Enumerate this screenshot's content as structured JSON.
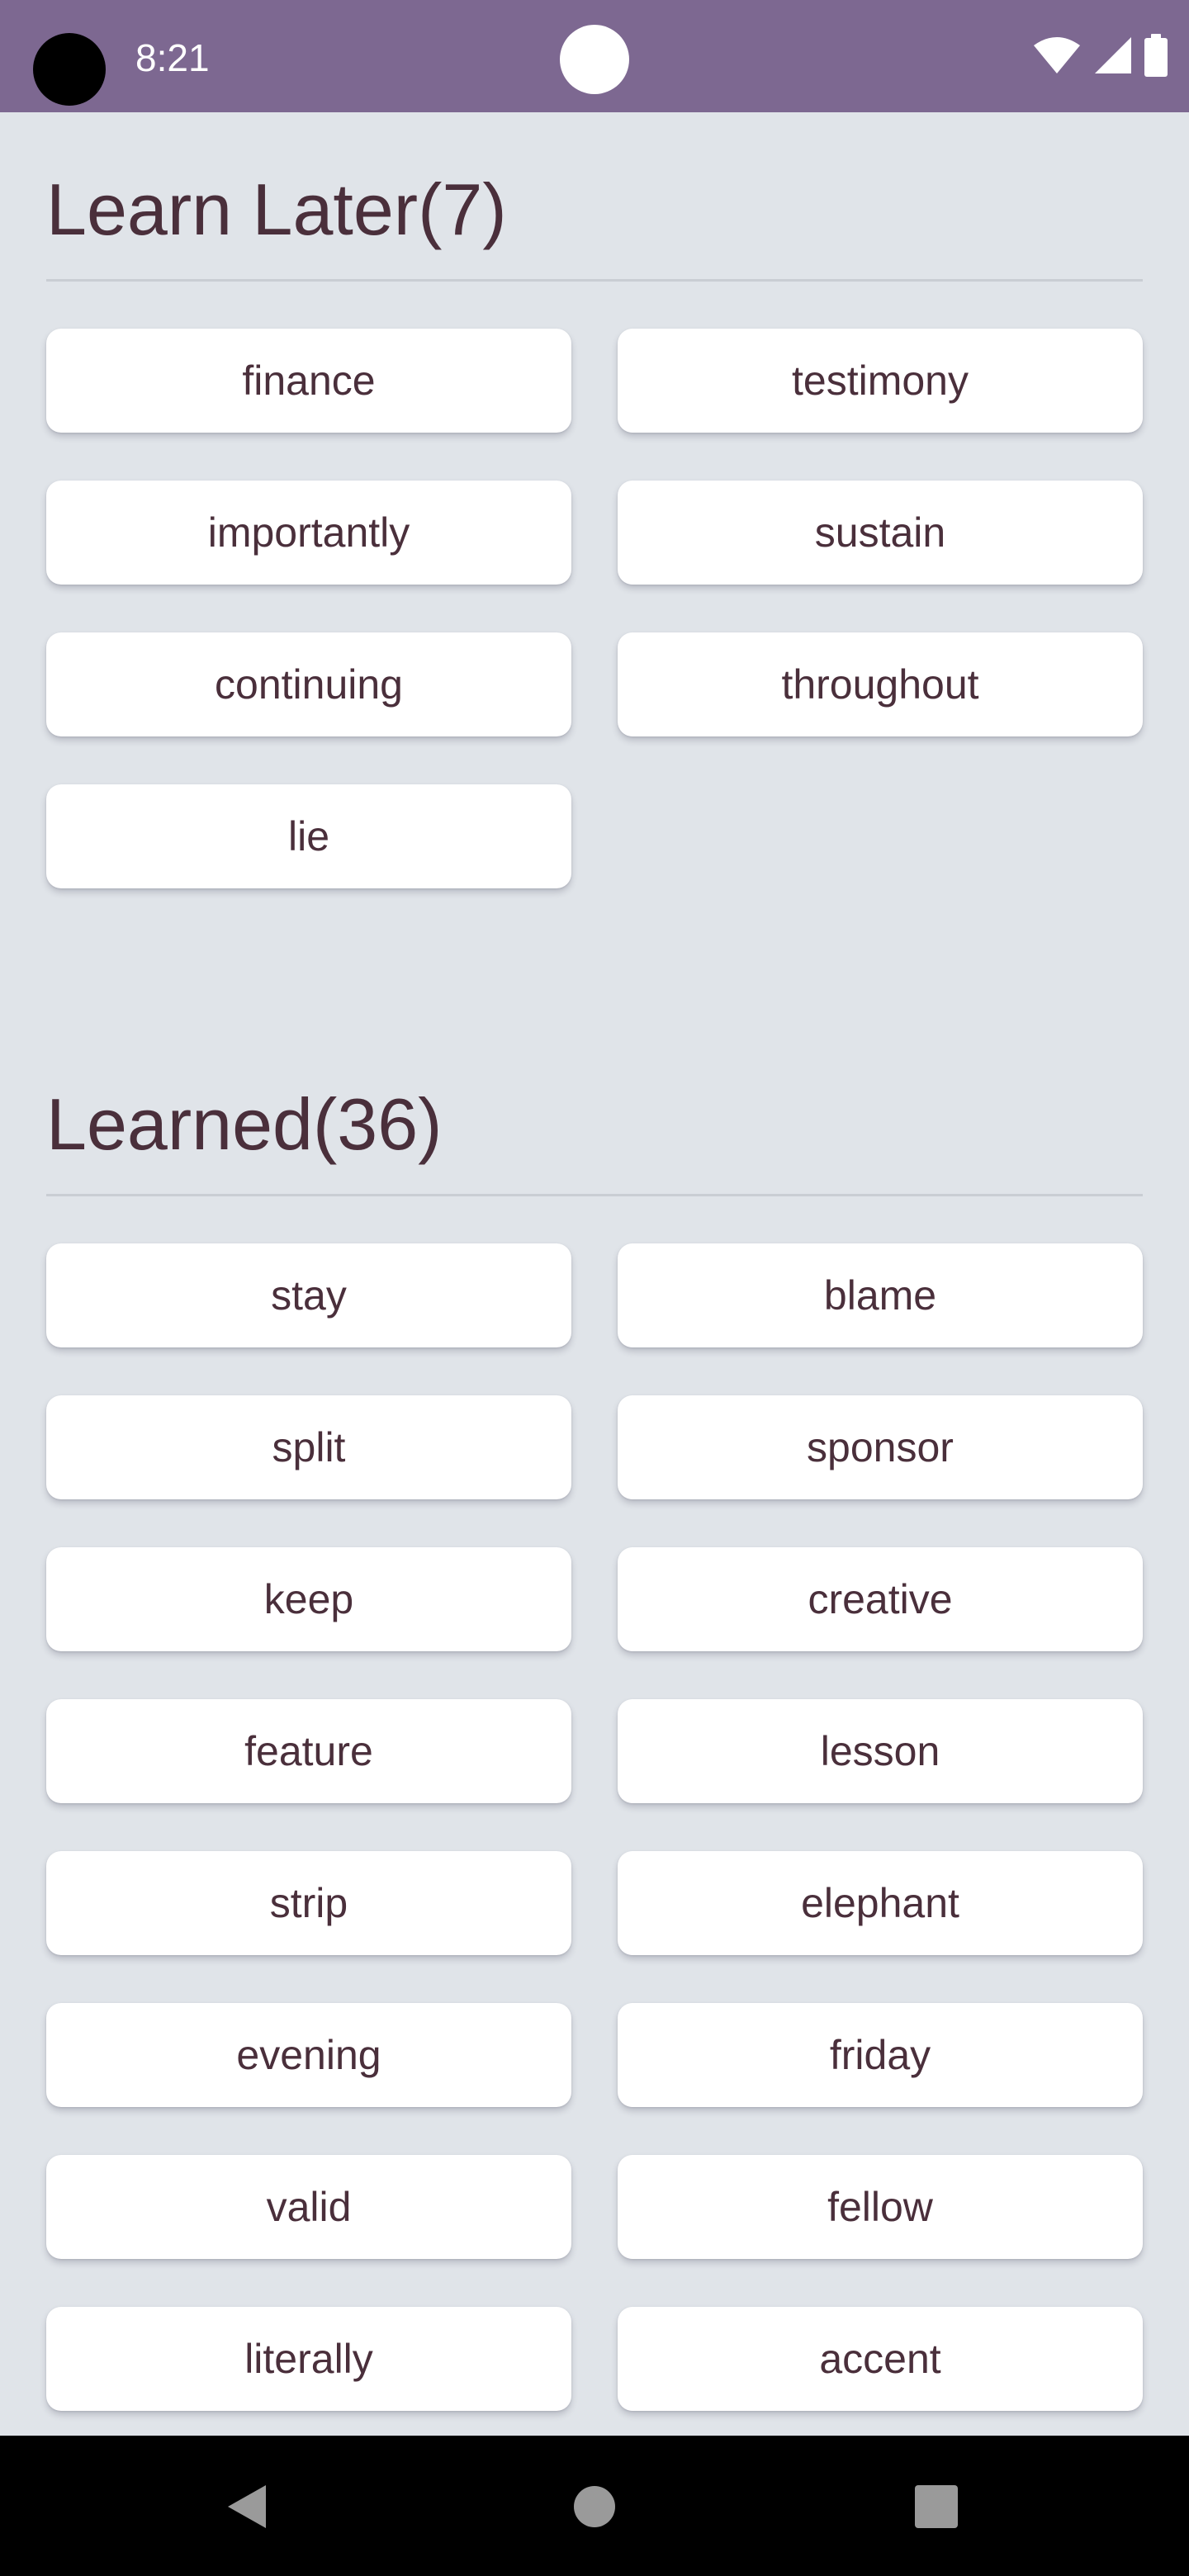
{
  "status_bar": {
    "time": "8:21",
    "background": "#7d6891",
    "icons": [
      "wifi-icon",
      "signal-icon",
      "battery-icon"
    ]
  },
  "learn_later": {
    "title": "Learn Later(7)",
    "words": [
      "finance",
      "testimony",
      "importantly",
      "sustain",
      "continuing",
      "throughout",
      "lie"
    ]
  },
  "learned": {
    "title": "Learned(36)",
    "words": [
      "stay",
      "blame",
      "split",
      "sponsor",
      "keep",
      "creative",
      "feature",
      "lesson",
      "strip",
      "elephant",
      "evening",
      "friday",
      "valid",
      "fellow",
      "literally",
      "accent"
    ]
  },
  "nav_bar": {
    "buttons": [
      "back-icon",
      "home-icon",
      "recents-icon"
    ]
  },
  "colors": {
    "background": "#e0e4e9",
    "card": "#ffffff",
    "text": "#4a2f3b"
  }
}
